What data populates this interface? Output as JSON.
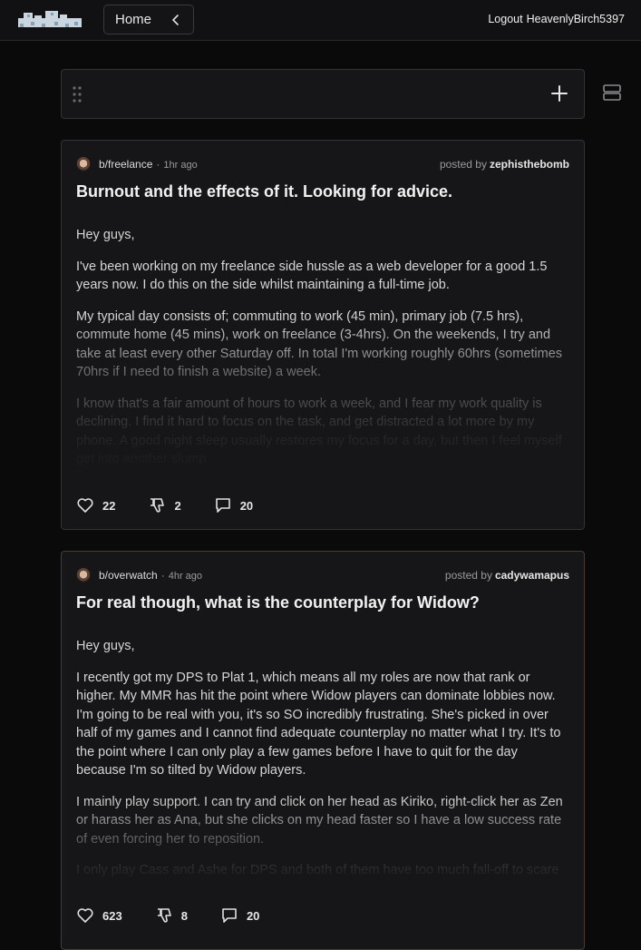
{
  "header": {
    "home_label": "Home",
    "logout_label": "Logout",
    "username": "HeavenlyBirch5397"
  },
  "posts": [
    {
      "board": "b/freelance",
      "time": "1hr ago",
      "posted_by_label": "posted by",
      "author": "zephisthebomb",
      "title": "Burnout and the effects of it. Looking for advice.",
      "paragraphs": [
        "Hey guys,",
        "I've been working on my freelance side hussle as a web developer for a good 1.5 years now. I do this on the side whilst maintaining a full-time job.",
        "My typical day consists of; commuting to work (45 min), primary job (7.5 hrs), commute home (45 mins), work on freelance (3-4hrs). On the weekends, I try and take at least every other Saturday off. In total I'm working roughly 60hrs (sometimes 70hrs if I need to finish a website) a week.",
        "I know that's a fair amount of hours to work a week, and I fear my work quality is declining. I find it hard to focus on the task, and get distracted a lot more by my phone. A good night sleep usually restores my focus for a day, but then I feel myself get into another slump."
      ],
      "likes": "22",
      "dislikes": "2",
      "comments": "20"
    },
    {
      "board": "b/overwatch",
      "time": "4hr ago",
      "posted_by_label": "posted by",
      "author": "cadywamapus",
      "title": "For real though, what is the counterplay for Widow?",
      "paragraphs": [
        "Hey guys,",
        "I recently got my DPS to Plat 1, which means all my roles are now that rank or higher. My MMR has hit the point where Widow players can dominate lobbies now. I'm going to be real with you, it's so SO incredibly frustrating. She's picked in over half of my games and I cannot find adequate counterplay no matter what I try. It's to the point where I can only play a few games before I have to quit for the day because I'm so tilted by Widow players.",
        "I mainly play support. I can try and click on her head as Kiriko, right-click her as Zen or harass her as Ana, but she clicks on my head faster so I have a low success rate of even forcing her to reposition.",
        "I only play Cass and Ashe for DPS and both of them have too much fall-off to scare"
      ],
      "likes": "623",
      "dislikes": "8",
      "comments": "20"
    }
  ]
}
